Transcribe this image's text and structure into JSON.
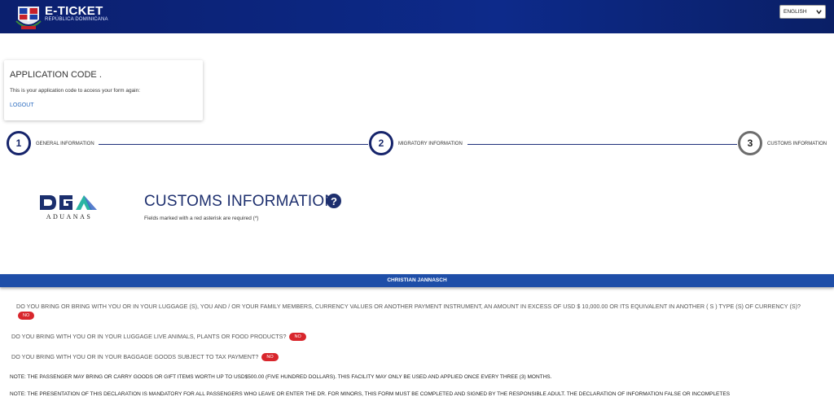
{
  "header": {
    "brand_title": "E-TICKET",
    "brand_subtitle": "REPÚBLICA DOMINICANA",
    "language": "ENGLISH"
  },
  "app_card": {
    "title": "APPLICATION CODE .",
    "description": "This is your application code to access your form again:",
    "logout": "LOGOUT"
  },
  "stepper": {
    "steps": [
      {
        "number": "1",
        "label": "GENERAL INFORMATION"
      },
      {
        "number": "2",
        "label": "MIGRATORY INFORMATION"
      },
      {
        "number": "3",
        "label": "CUSTOMS INFORMATION"
      }
    ]
  },
  "logo": {
    "text_top": "DGA",
    "text_bottom": "ADUANAS"
  },
  "section": {
    "title": "CUSTOMS INFORMATION",
    "help_icon": "?",
    "required_note": "Fields marked with a red asterisk are required (*)"
  },
  "passenger": {
    "name": "CHRISTIAN JANNASCH"
  },
  "questions": [
    {
      "text": "DO YOU BRING OR BRING WITH YOU OR IN YOUR LUGGAGE (S), YOU AND / OR YOUR FAMILY MEMBERS, CURRENCY VALUES OR ANOTHER PAYMENT INSTRUMENT, AN AMOUNT IN EXCESS OF USD $ 10,000.00 OR ITS EQUIVALENT IN ANOTHER ( S ) TYPE (S) OF CURRENCY (S)?",
      "answer": "NO"
    },
    {
      "text": "DO YOU BRING WITH YOU OR IN YOUR LUGGAGE LIVE ANIMALS, PLANTS OR FOOD PRODUCTS?",
      "answer": "NO"
    },
    {
      "text": "DO YOU BRING WITH YOU OR IN YOUR BAGGAGE GOODS SUBJECT TO TAX PAYMENT?",
      "answer": "NO"
    }
  ],
  "notes": {
    "note1": "NOTE: THE PASSENGER MAY BRING OR CARRY GOODS OR GIFT ITEMS WORTH UP TO USD$500.00 (FIVE HUNDRED DOLLARS). THIS FACILITY MAY ONLY BE USED AND APPLIED ONCE EVERY THREE (3) MONTHS.",
    "note2": "NOTE: THE PRESENTATION OF THIS DECLARATION IS MANDATORY FOR ALL PASSENGERS WHO LEAVE OR ENTER THE DR. FOR MINORS, THIS FORM MUST BE COMPLETED AND SIGNED BY THE RESPONSIBLE ADULT. THE DECLARATION OF INFORMATION FALSE OR INCOMPLETES"
  },
  "colors": {
    "header": "#0d2a8a",
    "accent": "#1e4ea8",
    "no_pill": "#d8262c"
  }
}
